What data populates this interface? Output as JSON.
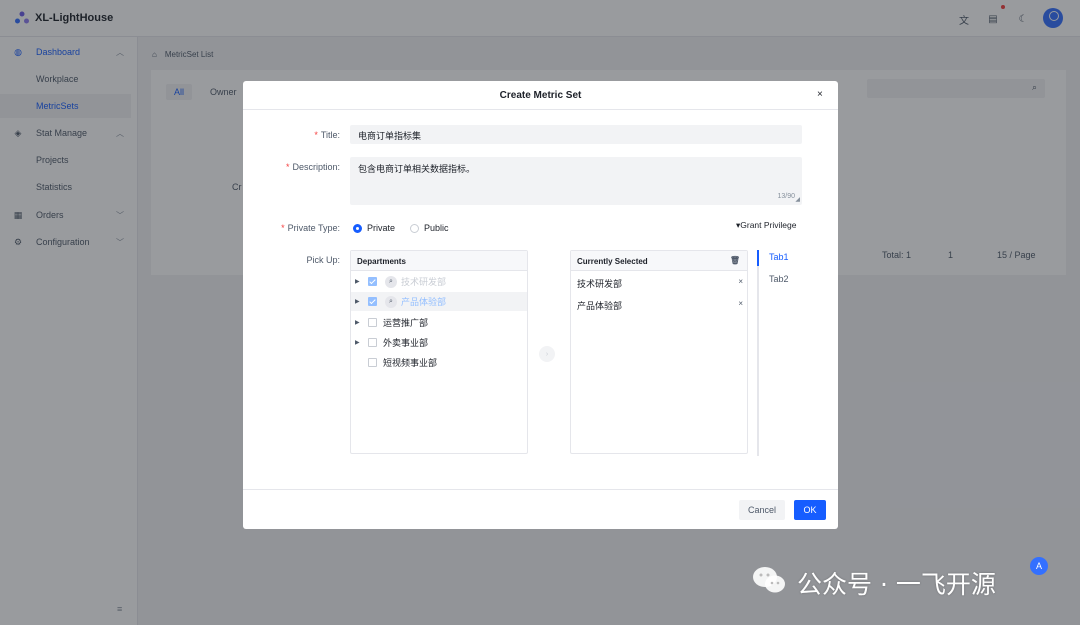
{
  "app": {
    "title": "XL-LightHouse"
  },
  "topbar": {
    "icons": [
      "translate-icon",
      "calendar-icon",
      "moon-icon",
      "user-avatar"
    ]
  },
  "sidebar": {
    "items": [
      {
        "label": "Dashboard",
        "icon": "dashboard-icon",
        "expanded": true
      },
      {
        "label": "Workplace"
      },
      {
        "label": "MetricSets",
        "selected": true
      },
      {
        "label": "Stat Manage",
        "icon": "stat-icon",
        "expanded": true
      },
      {
        "label": "Projects"
      },
      {
        "label": "Statistics"
      },
      {
        "label": "Orders",
        "icon": "orders-icon"
      },
      {
        "label": "Configuration",
        "icon": "config-icon"
      }
    ]
  },
  "breadcrumb": {
    "current": "MetricSet List"
  },
  "list": {
    "tabs": [
      "All",
      "Owner"
    ],
    "partial_text": "Cr",
    "total": "Total: 1",
    "page": "1",
    "page_size": "15 / Page"
  },
  "modal": {
    "title": "Create Metric Set",
    "close": "×",
    "form": {
      "title_label": "Title:",
      "title_value": "电商订单指标集",
      "description_label": "Description:",
      "description_value": "包含电商订单相关数据指标。",
      "description_count": "13/90",
      "private_type_label": "Private Type:",
      "private_option": "Private",
      "public_option": "Public",
      "grant_label": "▾Grant Privilege",
      "pickup_label": "Pick Up:"
    },
    "departments": {
      "header": "Departments",
      "items": [
        {
          "name": "技术研发部",
          "checked": true
        },
        {
          "name": "产品体验部",
          "checked": true
        },
        {
          "name": "运营推广部",
          "checked": false
        },
        {
          "name": "外卖事业部",
          "checked": false
        },
        {
          "name": "短视频事业部",
          "checked": false
        }
      ]
    },
    "selected": {
      "header": "Currently Selected",
      "items": [
        "技术研发部",
        "产品体验部"
      ]
    },
    "side_tabs": [
      "Tab1",
      "Tab2"
    ],
    "footer": {
      "cancel": "Cancel",
      "ok": "OK"
    }
  },
  "watermark": {
    "text": "公众号 · 一飞开源"
  },
  "colors": {
    "primary": "#165dff",
    "danger": "#f53f3f",
    "mask": "rgba(29,33,41,0.45)"
  }
}
